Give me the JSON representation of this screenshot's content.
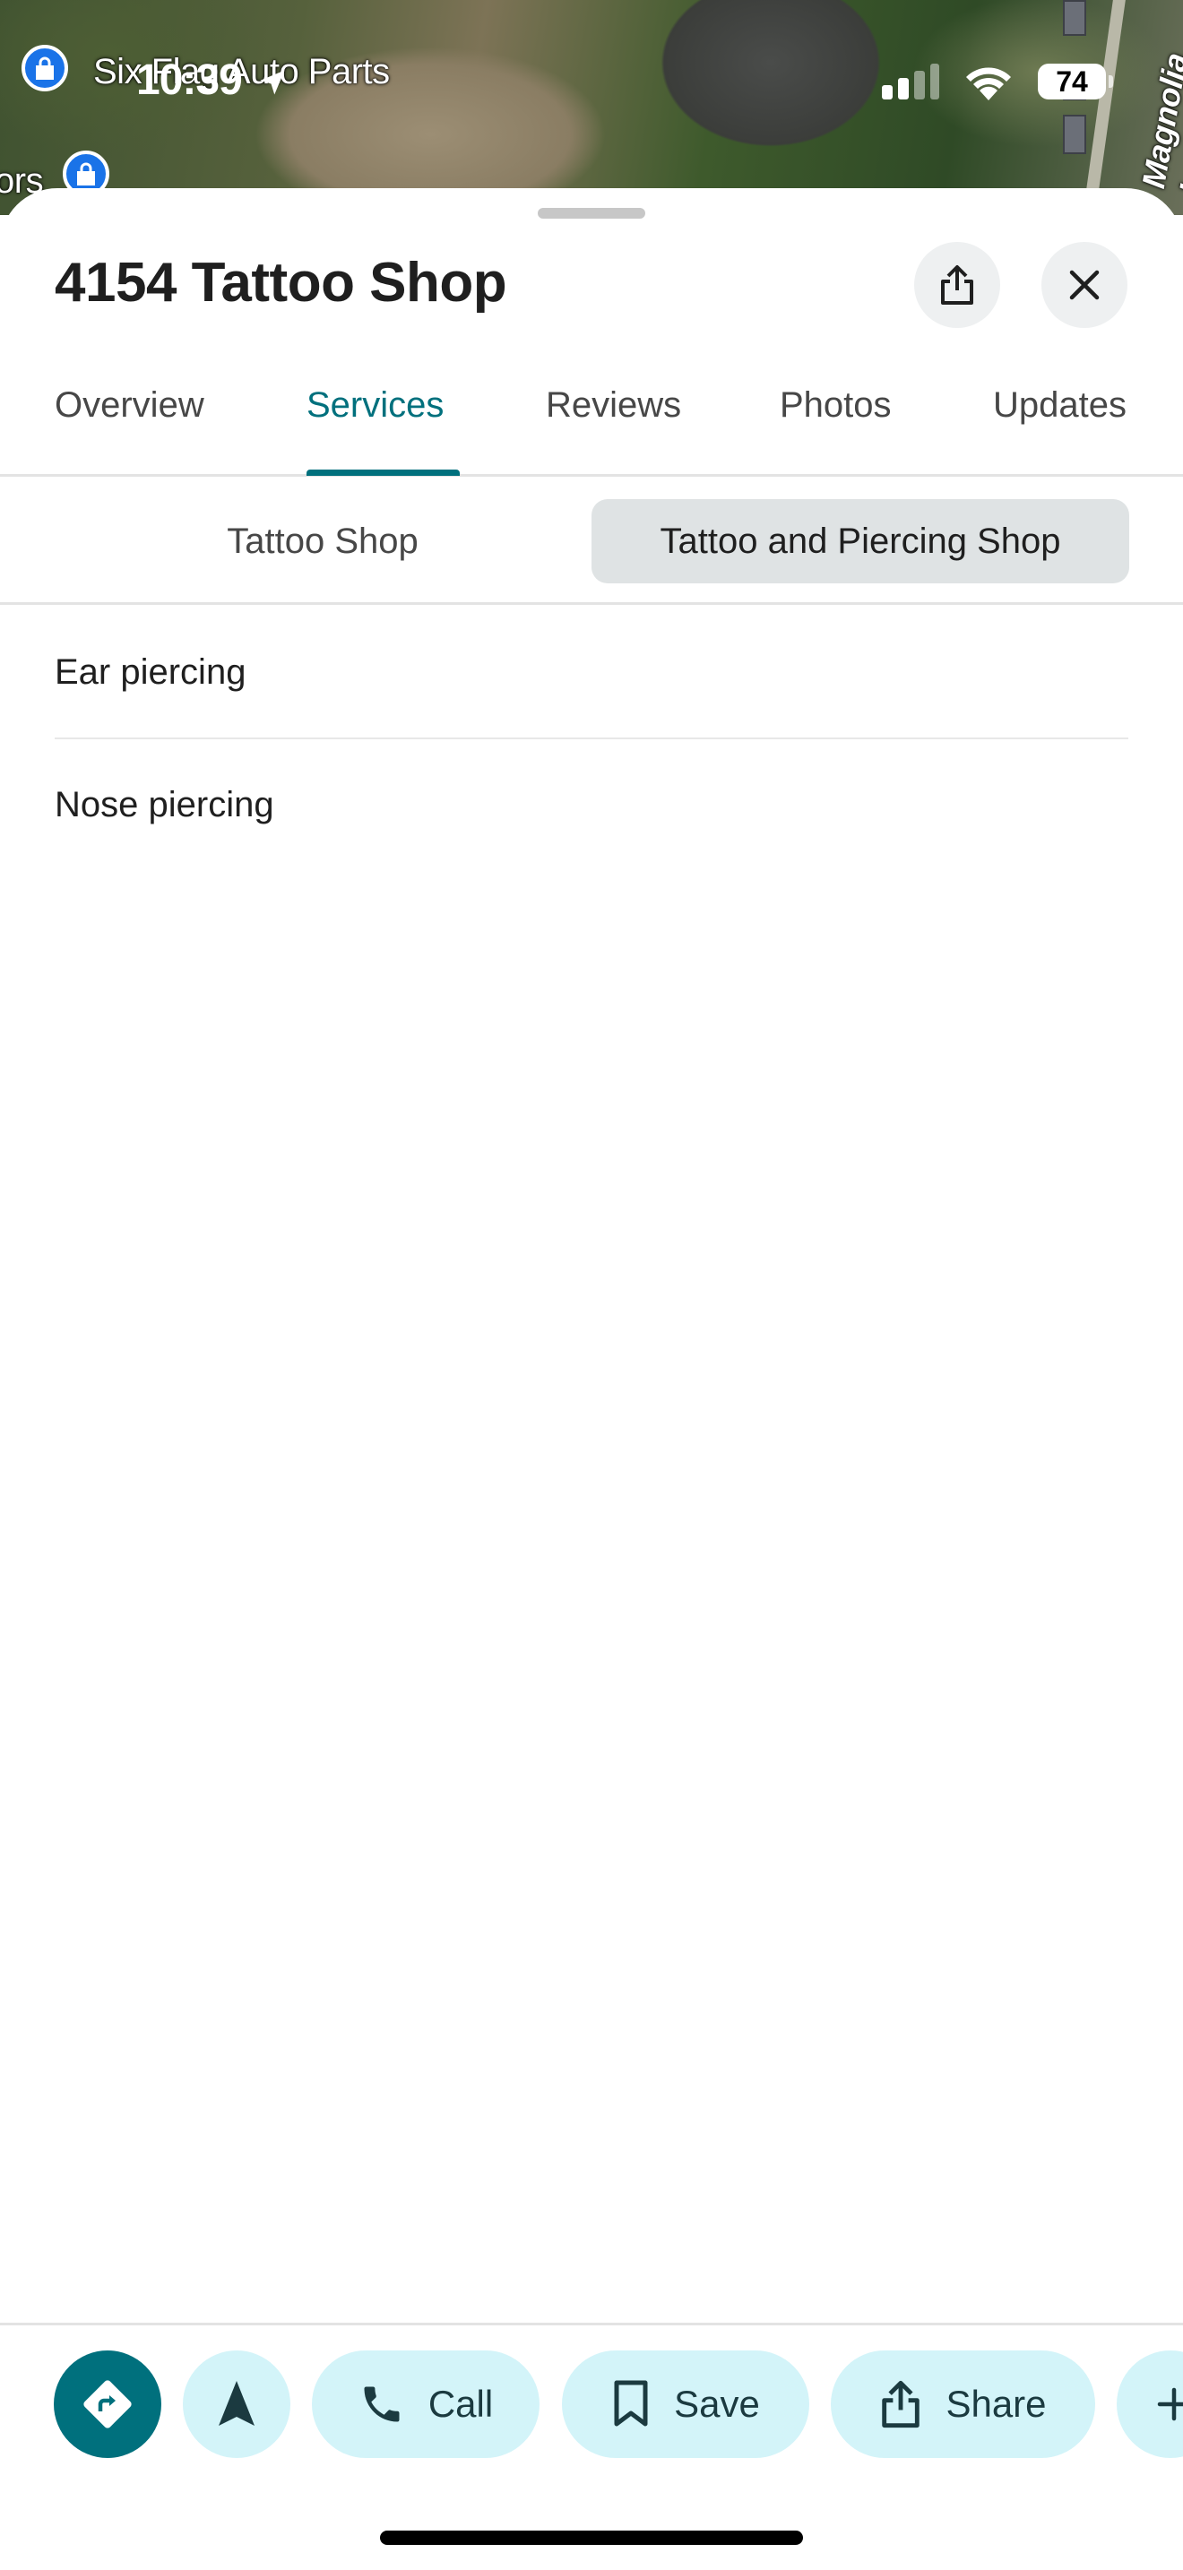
{
  "status_bar": {
    "time": "10:39",
    "battery": "74"
  },
  "map": {
    "labels": {
      "business": "Six Flag Auto Parts",
      "partial": "ors",
      "street": "Magnolia Ln"
    }
  },
  "place": {
    "title": "4154 Tattoo Shop"
  },
  "tabs": [
    {
      "label": "Overview",
      "active": false
    },
    {
      "label": "Services",
      "active": true
    },
    {
      "label": "Reviews",
      "active": false
    },
    {
      "label": "Photos",
      "active": false
    },
    {
      "label": "Updates",
      "active": false
    }
  ],
  "categories": [
    {
      "label": "Tattoo Shop",
      "selected": false
    },
    {
      "label": "Tattoo and Piercing Shop",
      "selected": true
    }
  ],
  "services": [
    {
      "label": "Ear piercing"
    },
    {
      "label": "Nose piercing"
    }
  ],
  "actions": {
    "call": "Call",
    "save": "Save",
    "share": "Share"
  },
  "colors": {
    "accent": "#00707d",
    "chip_selected": "#dfe3e4",
    "action_bg": "#d3f4f9"
  }
}
